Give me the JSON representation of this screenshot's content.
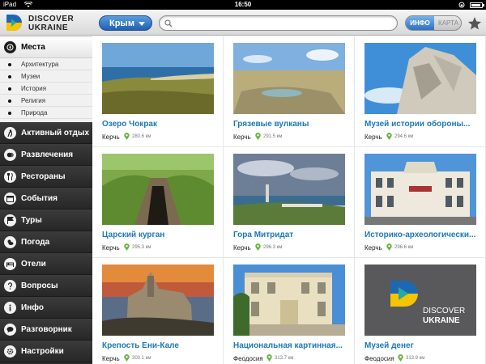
{
  "status_bar": {
    "carrier": "iPad",
    "time": "16:50"
  },
  "app": {
    "logo": {
      "line1": "DISCOVER",
      "line2": "UKRAINE"
    },
    "region_button": "Крым",
    "search": {
      "value": "",
      "placeholder": ""
    },
    "mode_toggle": {
      "info": "ИНФО",
      "map": "КАРТА",
      "selected": "ИНФО"
    },
    "icons": {
      "favorites": "star-icon",
      "search": "search-icon",
      "pin": "map-pin-icon"
    },
    "colors": {
      "accent_blue": "#1b78b8",
      "pin_green": "#6ab344"
    }
  },
  "sidebar": {
    "items": [
      {
        "label": "Места",
        "icon": "compass-icon",
        "active": true
      },
      {
        "label": "Активный отдых",
        "icon": "hiker-icon"
      },
      {
        "label": "Развлечения",
        "icon": "masks-icon"
      },
      {
        "label": "Рестораны",
        "icon": "cutlery-icon"
      },
      {
        "label": "События",
        "icon": "calendar-icon"
      },
      {
        "label": "Туры",
        "icon": "flag-icon"
      },
      {
        "label": "Погода",
        "icon": "weather-icon"
      },
      {
        "label": "Отели",
        "icon": "hotel-icon"
      },
      {
        "label": "Вопросы",
        "icon": "question-icon"
      },
      {
        "label": "Инфо",
        "icon": "info-icon"
      },
      {
        "label": "Разговорник",
        "icon": "speech-icon"
      },
      {
        "label": "Настройки",
        "icon": "gear-icon"
      }
    ],
    "subitems": [
      "Архитектура",
      "Музеи",
      "История",
      "Религия",
      "Природа"
    ]
  },
  "places": [
    {
      "title": "Озеро Чокрак",
      "city": "Керчь",
      "distance": "280.6 км",
      "scene": "lake"
    },
    {
      "title": "Грязевые вулканы",
      "city": "Керчь",
      "distance": "291.5 км",
      "scene": "mud"
    },
    {
      "title": "Музей истории обороны...",
      "city": "Керчь",
      "distance": "294.6 км",
      "scene": "monument"
    },
    {
      "title": "Царский курган",
      "city": "Керчь",
      "distance": "295.3 км",
      "scene": "kurgan"
    },
    {
      "title": "Гора Митридат",
      "city": "Керчь",
      "distance": "296.3 км",
      "scene": "mountain"
    },
    {
      "title": "Историко-археологически...",
      "city": "Керчь",
      "distance": "296.6 км",
      "scene": "building"
    },
    {
      "title": "Крепость Ени-Кале",
      "city": "Керчь",
      "distance": "300.1 км",
      "scene": "fortress"
    },
    {
      "title": "Национальная картинная...",
      "city": "Феодосия",
      "distance": "313.7 км",
      "scene": "gallery"
    },
    {
      "title": "Музей денег",
      "city": "Феодосия",
      "distance": "313.9 км",
      "scene": "logo"
    }
  ]
}
